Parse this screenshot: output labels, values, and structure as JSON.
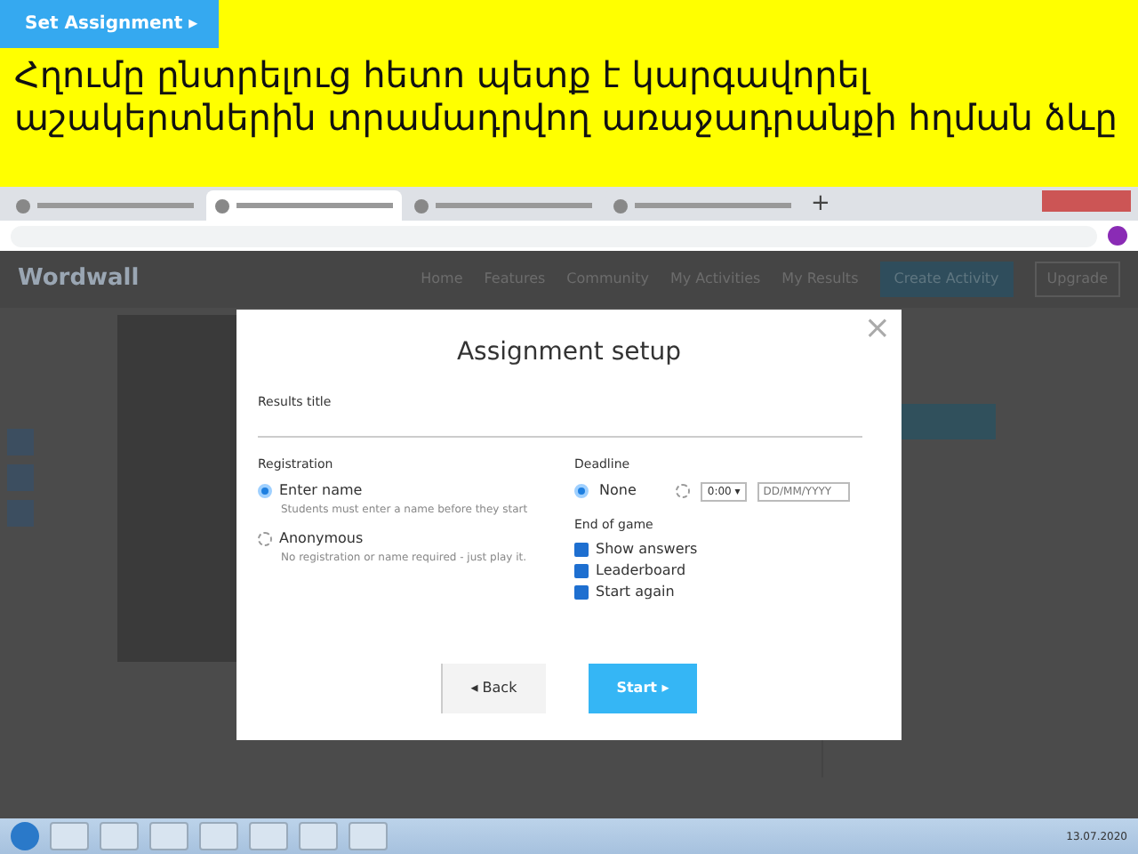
{
  "slide": {
    "button": "Set Assignment ▸",
    "heading": "Հղումը ընտրելուց հետո պետք է կարգավորել աշակերտներին տրամադրվող առաջադրանքի հղման ձևը"
  },
  "browser": {
    "tabs": [
      {
        "selected": false
      },
      {
        "selected": true
      },
      {
        "selected": false
      },
      {
        "selected": false
      }
    ],
    "new_tab": "+"
  },
  "site": {
    "logo": "Wordwall",
    "nav": [
      "Home",
      "Features",
      "Community",
      "My Activities",
      "My Results"
    ],
    "create": "Create Activity",
    "upgrade": "Upgrade"
  },
  "modal": {
    "close": "×",
    "title": "Assignment setup",
    "results_label": "Results title",
    "registration_label": "Registration",
    "registration": [
      {
        "label": "Enter name",
        "hint": "Students must enter a name before they start",
        "selected": true
      },
      {
        "label": "Anonymous",
        "hint": "No registration or name required - just play it.",
        "selected": false
      }
    ],
    "deadline_label": "Deadline",
    "deadline": [
      {
        "kind": "none",
        "label": "None",
        "selected": true
      },
      {
        "kind": "date",
        "time": "0:00",
        "caret": "▾",
        "placeholder": "DD/MM/YYYY",
        "selected": false
      }
    ],
    "end_label": "End of game",
    "end": [
      {
        "label": "Show answers",
        "checked": true
      },
      {
        "label": "Leaderboard",
        "checked": true
      },
      {
        "label": "Start again",
        "checked": true
      }
    ],
    "back": "◂ Back",
    "start": "Start ▸"
  },
  "taskbar": {
    "date": "13.07.2020"
  }
}
